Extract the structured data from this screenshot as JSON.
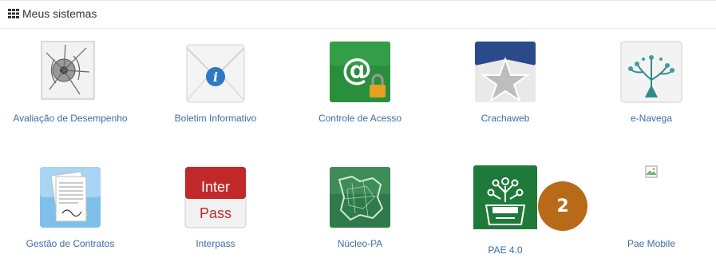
{
  "panel": {
    "title": "Meus sistemas",
    "icon": "grid-icon"
  },
  "tiles": [
    {
      "label": "Avaliação de Desempenho",
      "icon": "target-icon"
    },
    {
      "label": "Boletim Informativo",
      "icon": "info-envelope-icon"
    },
    {
      "label": "Controle de Acesso",
      "icon": "at-lock-icon"
    },
    {
      "label": "Crachaweb",
      "icon": "star-badge-icon"
    },
    {
      "label": "e-Navega",
      "icon": "tree-icon"
    },
    {
      "label": "Gestão de Contratos",
      "icon": "documents-icon"
    },
    {
      "label": "Interpass",
      "icon_text_top": "Inter",
      "icon_text_bottom": "Pass",
      "icon": "interpass-icon"
    },
    {
      "label": "Núcleo-PA",
      "icon": "map-icon"
    },
    {
      "label": "PAE 4.0",
      "icon": "inbox-tree-icon"
    },
    {
      "label": "Pae Mobile",
      "icon": "broken-image-icon"
    }
  ],
  "badge": {
    "value": "2"
  },
  "colors": {
    "link": "#3a6ea5",
    "badge": "#b86a18"
  }
}
